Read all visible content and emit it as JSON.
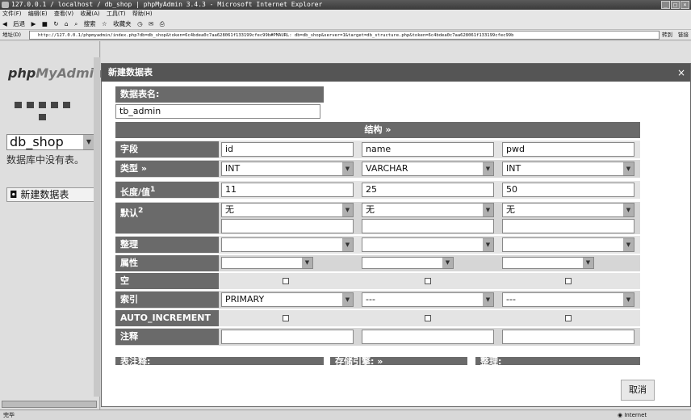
{
  "window": {
    "title": "127.0.0.1 / localhost / db_shop | phpMyAdmin 3.4.3 - Microsoft Internet Explorer"
  },
  "menu": [
    "文件(F)",
    "编辑(E)",
    "查看(V)",
    "收藏(A)",
    "工具(T)",
    "帮助(H)"
  ],
  "toolbar": [
    "后退",
    "搜索",
    "收藏夹"
  ],
  "address": {
    "label": "地址(D)",
    "url": "http://127.0.0.1/phpmyadmin/index.php?db=db_shop&token=6c4bdea0c7aa628061f133199cfec99b#PMAURL: db=db_shop&server=1&target=db_structure.php&token=6c4bdea0c7aa628061f133199cfec99b",
    "go": "转到",
    "links": "链接"
  },
  "left": {
    "logo_php": "php",
    "logo_rest": "MyAdmin",
    "db": "db_shop",
    "nodb": "数据库中没有表。",
    "new_table": "新建数据表"
  },
  "dialog": {
    "title": "新建数据表",
    "close": "×",
    "table_name_label": "数据表名:",
    "table_name": "tb_admin",
    "structure_label": "结构",
    "structure_mark": "»",
    "labels": {
      "field": "字段",
      "type": "类型",
      "type_mark": "»",
      "length": "长度/值",
      "length_sup": "1",
      "default": "默认",
      "default_sup": "2",
      "collation": "整理",
      "attributes": "属性",
      "null": "空",
      "index": "索引",
      "auto_increment": "AUTO_INCREMENT",
      "comment": "注释"
    },
    "columns": [
      {
        "field": "id",
        "type": "INT",
        "length": "11",
        "default": "无",
        "index": "PRIMARY"
      },
      {
        "field": "name",
        "type": "VARCHAR",
        "length": "25",
        "default": "无",
        "index": "---"
      },
      {
        "field": "pwd",
        "type": "INT",
        "length": "50",
        "default": "无",
        "index": "---"
      }
    ],
    "bottom_labels": [
      "表注释:",
      "存储引擎:",
      "整理:"
    ],
    "bottom_mark": "»",
    "cancel": "取消"
  },
  "status": {
    "done": "完毕",
    "zone": "Internet"
  }
}
